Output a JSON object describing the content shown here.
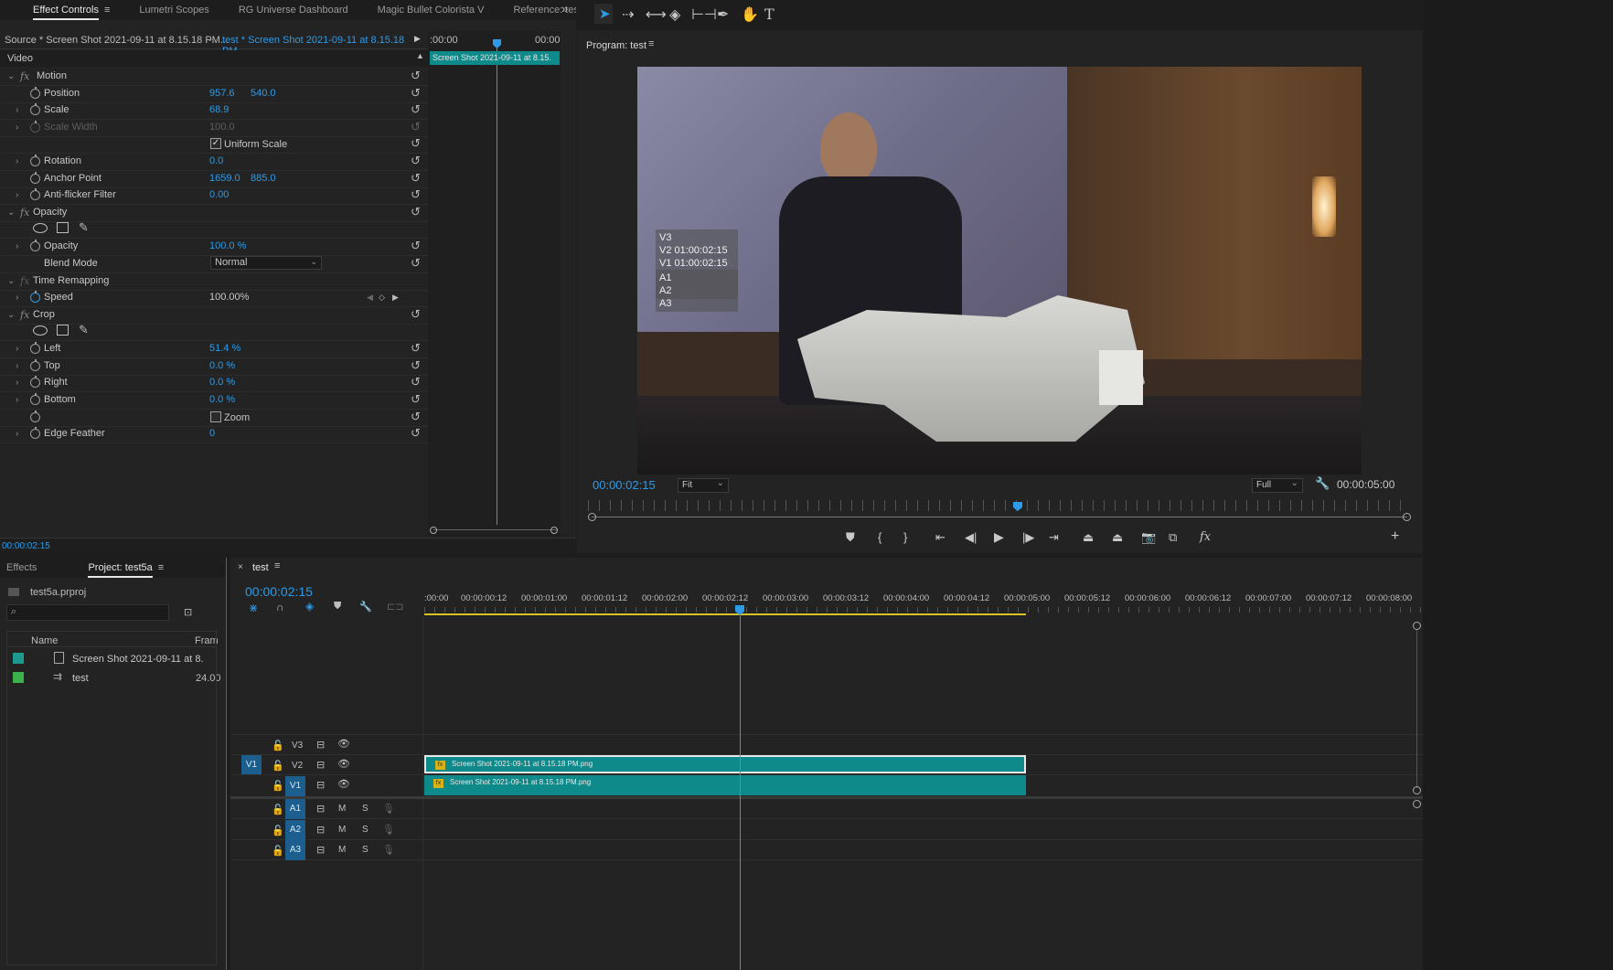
{
  "effect_controls": {
    "tabs": [
      "Effect Controls",
      "Lumetri Scopes",
      "RG Universe Dashboard",
      "Magic Bullet Colorista V",
      "Reference: test"
    ],
    "source_label": "Source * Screen Shot 2021-09-11 at 8.15.18 PM...",
    "clip_label": "test * Screen Shot 2021-09-11 at 8.15.18 PM...",
    "time_start": ":00:00",
    "time_end": "00:00",
    "mini_clip": "Screen Shot 2021-09-11 at 8.15.",
    "section": "Video",
    "motion": "Motion",
    "position_label": "Position",
    "position_x": "957.6",
    "position_y": "540.0",
    "scale_label": "Scale",
    "scale_value": "68.9",
    "scale_width_label": "Scale Width",
    "scale_width_value": "100.0",
    "uniform_scale": "Uniform Scale",
    "rotation_label": "Rotation",
    "rotation_value": "0.0",
    "anchor_label": "Anchor Point",
    "anchor_x": "1659.0",
    "anchor_y": "885.0",
    "antiflicker_label": "Anti-flicker Filter",
    "antiflicker_value": "0.00",
    "opacity_group": "Opacity",
    "opacity_label": "Opacity",
    "opacity_value": "100.0 %",
    "blend_label": "Blend Mode",
    "blend_value": "Normal",
    "time_remap": "Time Remapping",
    "speed_label": "Speed",
    "speed_value": "100.00%",
    "crop_group": "Crop",
    "left_label": "Left",
    "left_value": "51.4 %",
    "top_label": "Top",
    "top_value": "0.0 %",
    "right_label": "Right",
    "right_value": "0.0 %",
    "bottom_label": "Bottom",
    "bottom_value": "0.0 %",
    "zoom_label": "Zoom",
    "feather_label": "Edge Feather",
    "feather_value": "0",
    "timecode": "00:00:02:15"
  },
  "program": {
    "title": "Program: test",
    "overlay": [
      "V3",
      "V2 01:00:02:15",
      "V1 01:00:02:15",
      "A1",
      "A2",
      "A3"
    ],
    "timecode": "00:00:02:15",
    "fit": "Fit",
    "quality": "Full",
    "duration": "00:00:05:00"
  },
  "project": {
    "tabs": [
      "Effects",
      "Project: test5a"
    ],
    "file": "test5a.prproj",
    "search_placeholder": "",
    "col_name": "Name",
    "col_frame": "Fram",
    "items": [
      {
        "name": "Screen Shot 2021-09-11 at 8.",
        "frame": "",
        "color": "#1d9a8e"
      },
      {
        "name": "test",
        "frame": "24.00",
        "color": "#3bb34a"
      }
    ]
  },
  "timeline": {
    "tab": "test",
    "timecode": "00:00:02:15",
    "ruler": [
      ":00:00",
      "00:00:00:12",
      "00:00:01:00",
      "00:00:01:12",
      "00:00:02:00",
      "00:00:02:12",
      "00:00:03:00",
      "00:00:03:12",
      "00:00:04:00",
      "00:00:04:12",
      "00:00:05:00",
      "00:00:05:12",
      "00:00:06:00",
      "00:00:06:12",
      "00:00:07:00",
      "00:00:07:12",
      "00:00:08:00"
    ],
    "tracks_v": [
      "V3",
      "V2",
      "V1"
    ],
    "tracks_a": [
      "A1",
      "A2",
      "A3"
    ],
    "src_patch": "V1",
    "clip_v2": "Screen Shot 2021-09-11 at 8.15.18 PM.png",
    "clip_v1": "Screen Shot 2021-09-11 at 8.15.18 PM.png",
    "mute": "M",
    "solo": "S"
  }
}
